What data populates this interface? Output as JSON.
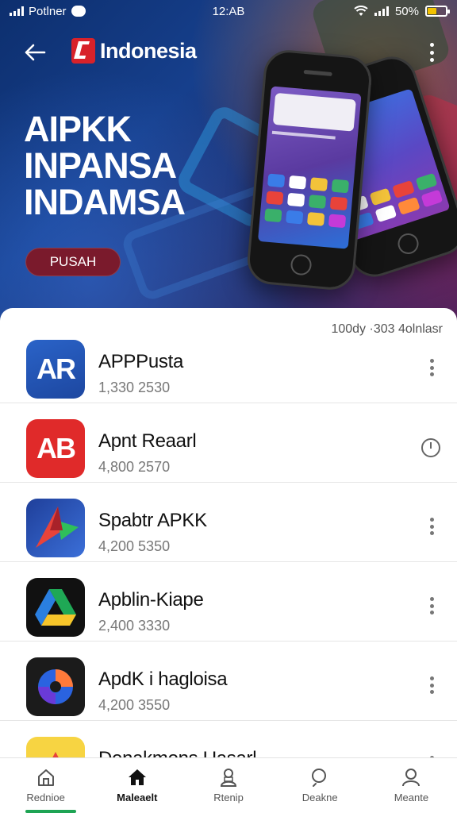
{
  "status_bar": {
    "carrier": "Potlner",
    "time": "12:AB",
    "battery": "50%",
    "battery_level": 0.5
  },
  "header": {
    "brand": "Indonesia"
  },
  "hero": {
    "title_lines": [
      "AIPKK",
      "INPANSA",
      "INDAMSA"
    ],
    "cta_label": "PUSAH"
  },
  "list": {
    "meta": "100dy ·303 4olnlasr",
    "items": [
      {
        "name": "APPPusta",
        "stats": "1,330  2530",
        "icon_text": "AR",
        "action": "more-menu"
      },
      {
        "name": "Apnt Reaarl",
        "stats": "4,800  2570",
        "icon_text": "AB",
        "action": "timer"
      },
      {
        "name": "Spabtr APKK",
        "stats": "4,200  5350",
        "icon_text": "",
        "action": "more-menu"
      },
      {
        "name": "Apblin-Kiape",
        "stats": "2,400  3330",
        "icon_text": "",
        "action": "more-menu"
      },
      {
        "name": "ApdK i hagloisa",
        "stats": "4,200  3550",
        "icon_text": "",
        "action": "more-menu"
      },
      {
        "name": "Denakmons Uasarl",
        "stats": "",
        "icon_text": "",
        "action": "more-menu"
      }
    ]
  },
  "bottom_nav": {
    "items": [
      {
        "label": "Rednioe",
        "icon": "home-outline-icon",
        "active": false
      },
      {
        "label": "Maleaelt",
        "icon": "home-filled-icon",
        "active": true
      },
      {
        "label": "Rtenip",
        "icon": "person-outline-icon",
        "active": false
      },
      {
        "label": "Deakne",
        "icon": "search-icon",
        "active": false
      },
      {
        "label": "Meante",
        "icon": "profile-icon",
        "active": false
      }
    ]
  },
  "colors": {
    "accent": "#d8222a",
    "cta": "#7a1a2c",
    "hero_bg": "#163f8c",
    "active_indicator": "#1ea454"
  }
}
